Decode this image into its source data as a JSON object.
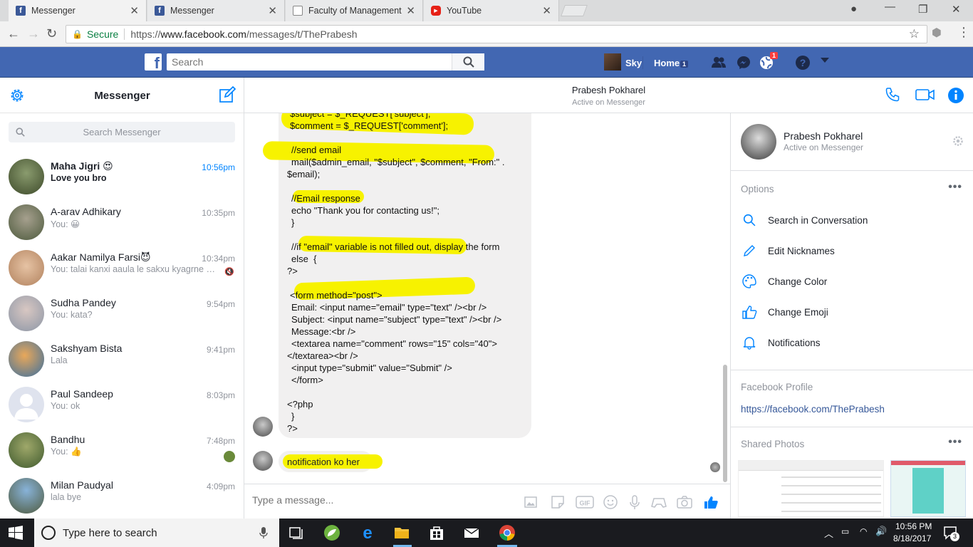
{
  "browser": {
    "tabs": [
      {
        "title": "Messenger",
        "favicon": "facebook-icon",
        "active": true
      },
      {
        "title": "Messenger",
        "favicon": "facebook-icon",
        "active": false
      },
      {
        "title": "Faculty of Management,",
        "favicon": "page-icon",
        "active": false
      },
      {
        "title": "YouTube",
        "favicon": "youtube-icon",
        "active": false
      }
    ],
    "secure_label": "Secure",
    "url_prefix": "https://",
    "url_host": "www.facebook.com",
    "url_path": "/messages/t/ThePrabesh"
  },
  "fbbar": {
    "search_placeholder": "Search",
    "profile_name": "Sky",
    "home_label": "Home",
    "home_badge": "1",
    "notif_badge": "1",
    "brand_color": "#4267b2"
  },
  "left": {
    "title": "Messenger",
    "search_placeholder": "Search Messenger",
    "conversations": [
      {
        "name": "Maha Jigri 😍",
        "snippet": "Love you bro",
        "time": "10:56pm",
        "unread": true
      },
      {
        "name": "A-arav Adhikary",
        "snippet": "You: 😀",
        "time": "10:35pm",
        "unread": false
      },
      {
        "name": "Aakar Namilya Farsi😈",
        "snippet": "You: talai kanxi aaula le sakxu kyagrne ma...",
        "time": "10:34pm",
        "unread": false
      },
      {
        "name": "Sudha Pandey",
        "snippet": "You: kata?",
        "time": "9:54pm",
        "unread": false
      },
      {
        "name": "Sakshyam Bista",
        "snippet": "Lala",
        "time": "9:41pm",
        "unread": false
      },
      {
        "name": "Paul Sandeep",
        "snippet": "You: ok",
        "time": "8:03pm",
        "unread": false
      },
      {
        "name": "Bandhu",
        "snippet": "You: 👍",
        "time": "7:48pm",
        "unread": false
      },
      {
        "name": "Milan Paudyal",
        "snippet": "lala bye",
        "time": "4:09pm",
        "unread": false
      }
    ]
  },
  "chat": {
    "contact_name": "Prabesh Pokharel",
    "contact_status": "Active on Messenger",
    "code_lines": [
      "$subject = $_REQUEST['subject'];",
      "$comment = $_REQUEST['comment'];",
      "",
      "//send email",
      "mail($admin_email, \"$subject\", $comment, \"From:\" .",
      "$email);",
      "",
      "//Email response",
      "echo \"Thank you for contacting us!\";",
      "}",
      "",
      "//if \"email\" variable is not filled out, display the form",
      "else  {",
      "?>",
      "",
      "<form method=\"post\">",
      "Email: <input name=\"email\" type=\"text\" /><br />",
      "Subject: <input name=\"subject\" type=\"text\" /><br />",
      "Message:<br />",
      "<textarea name=\"comment\" rows=\"15\" cols=\"40\">",
      "</textarea><br />",
      "<input type=\"submit\" value=\"Submit\" />",
      "</form>",
      "",
      "<?php",
      "}",
      "?>"
    ],
    "last_message": "notification ko her",
    "composer_placeholder": "Type a message...",
    "highlight_color": "#f7f200"
  },
  "right": {
    "name": "Prabesh Pokharel",
    "status": "Active on Messenger",
    "options_title": "Options",
    "options": [
      {
        "label": "Search in Conversation",
        "icon": "search-icon"
      },
      {
        "label": "Edit Nicknames",
        "icon": "pencil-icon"
      },
      {
        "label": "Change Color",
        "icon": "palette-icon"
      },
      {
        "label": "Change Emoji",
        "icon": "thumbs-up-icon"
      },
      {
        "label": "Notifications",
        "icon": "bell-icon"
      }
    ],
    "profile_title": "Facebook Profile",
    "profile_link": "https://facebook.com/ThePrabesh",
    "photos_title": "Shared Photos"
  },
  "taskbar": {
    "search_placeholder": "Type here to search",
    "time": "10:56 PM",
    "date": "8/18/2017",
    "notif_count": "3"
  }
}
